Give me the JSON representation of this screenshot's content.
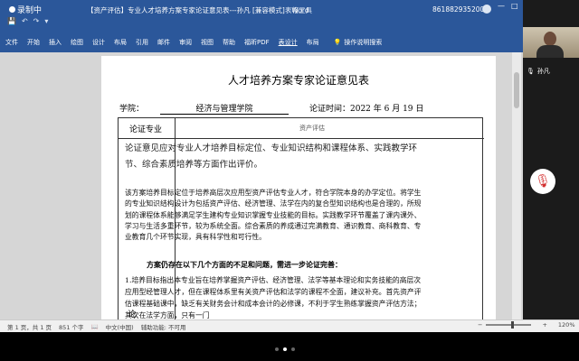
{
  "titlebar": {
    "recorder": "录制中",
    "qat": [
      "💾",
      "↶",
      "↷",
      "▾"
    ],
    "title": "【资产评估】专业人才培养方案专家论证意见表---孙凡 [兼容模式] - Word",
    "table_tools": "表格工具",
    "phone": "8618829352009",
    "win_buttons": [
      "—",
      "□",
      "✕"
    ]
  },
  "ribbon": {
    "tabs": [
      "文件",
      "开始",
      "插入",
      "绘图",
      "设计",
      "布局",
      "引用",
      "邮件",
      "审阅",
      "视图",
      "帮助",
      "福昕PDF",
      "表设计",
      "布局"
    ],
    "active_tab": "表设计",
    "tell_me": "操作说明搜索"
  },
  "video": {
    "participant": "孙凡"
  },
  "doc": {
    "heading": "人才培养方案专家论证意见表",
    "school_label": "学院：",
    "school_value": "经济与管理学院",
    "date_label": "论证时间：2022 年 6 月 19 日",
    "col_header": "论证专业",
    "col_value": "资产评估",
    "row_label": "论",
    "intro": "论证意见应对专业人才培养目标定位、专业知识结构和课程体系、实践教学环节、综合素质培养等方面作出评价。",
    "para1": "该方案培养目标定位于培养高层次应用型资产评估专业人才，符合学院本身的办学定位。将学生的专业知识结构设计为包括资产评估、经济管理、法学在内的复合型知识结构也是合理的，所规划的课程体系能够满足学生建构专业知识掌握专业技能的目标。实践教学环节覆盖了课内课外、学习与生活多重环节，较为系统全面。综合素质的养成通过完满教育、通识教育、商科教育、专业教育几个环节实现，具有科学性和可行性。",
    "para_subhead": "方案仍存在以下几个方面的不足和问题，需进一步论证完善：",
    "para2": "1.培养目标指出本专业旨在培养掌握资产评估、经济管理、法学等基本理论和实务技能的高层次应用型经管理人才，但在课程体系里有关资产评估和法学的课程不全面，建议补充。首先资产评估课程基础课中，缺乏有关财务会计和成本会计的必修课，不利于学生熟练掌握资产评估方法；其次在法学方面，只有一门"
  },
  "status": {
    "page": "第 1 页，共 1 页",
    "words": "851 个字",
    "lang": "中文(中国)",
    "access": "辅助功能: 不可用",
    "zoom": "120%",
    "zoom_level": 0.6
  },
  "pager": {
    "pages": 3,
    "current": 2
  },
  "colors": {
    "word_blue": "#2b579a",
    "mic_red": "#d32f2f"
  }
}
